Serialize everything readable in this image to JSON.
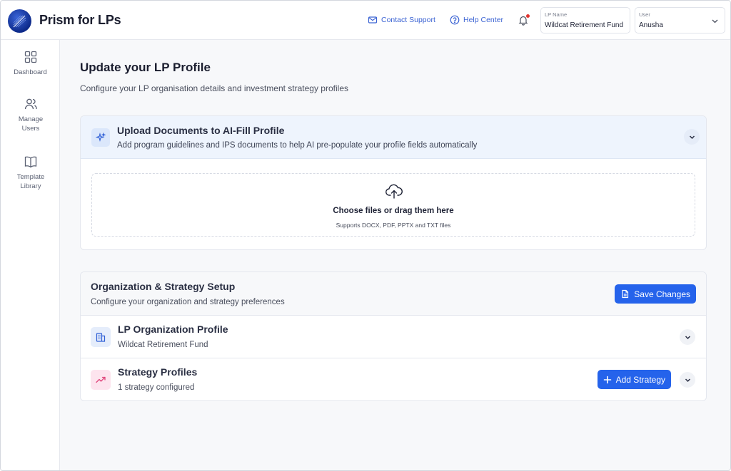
{
  "header": {
    "app_title": "Prism for LPs",
    "contact_support": "Contact Support",
    "help_center": "Help Center",
    "lp_name_label": "LP Name",
    "lp_name_value": "Wildcat Retirement Fund",
    "user_label": "User",
    "user_value": "Anusha"
  },
  "sidebar": {
    "items": [
      {
        "label": "Dashboard",
        "icon": "grid-icon"
      },
      {
        "label": "Manage Users",
        "icon": "users-icon"
      },
      {
        "label": "Template Library",
        "icon": "book-icon"
      }
    ]
  },
  "page": {
    "title": "Update your LP Profile",
    "subtitle": "Configure your LP organisation details and investment strategy profiles"
  },
  "upload": {
    "title": "Upload Documents to AI-Fill Profile",
    "description": "Add program guidelines and IPS documents to help AI pre-populate your profile fields automatically",
    "dropzone_main": "Choose files or drag them here",
    "dropzone_sub": "Supports DOCX, PDF, PPTX and TXT files"
  },
  "setup": {
    "title": "Organization & Strategy Setup",
    "description": "Configure your organization and strategy preferences",
    "save_label": "Save Changes",
    "org_profile": {
      "title": "LP Organization Profile",
      "subtitle": "Wildcat Retirement Fund"
    },
    "strategy": {
      "title": "Strategy Profiles",
      "subtitle": "1 strategy configured",
      "add_label": "Add Strategy"
    }
  },
  "colors": {
    "accent": "#2563eb",
    "link": "#3b63d3",
    "notification_dot": "#e0342f",
    "strategy_icon_bg": "#fde4ee",
    "org_icon_bg": "#e5edfb"
  }
}
